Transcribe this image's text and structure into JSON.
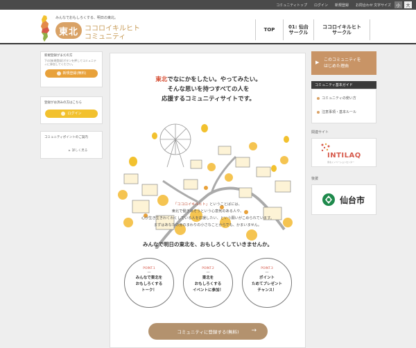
{
  "topbar": {
    "links": [
      "コミュニティトップ",
      "ログイン",
      "新規登録",
      "お問合わせ"
    ],
    "font_size_label": "文字サイズ",
    "font_small": "小",
    "font_large": "大"
  },
  "header": {
    "tagline": "みんなでおもしろくする、明日の東北。",
    "logo_mark": "東北",
    "logo_line1": "ココロイキルヒト",
    "logo_line2": "コミュニティ",
    "nav": [
      {
        "label": "TOP"
      },
      {
        "label": "01: 仙台\nサークル"
      },
      {
        "label": "ココロイキルヒト\nサークル"
      }
    ]
  },
  "left": {
    "register_title": "新規登録がまだの方",
    "register_desc": "下の[新規登録]ボタンを押してコミュニティに参加してください。",
    "register_button": "新規登録(無料)",
    "login_title": "登録がお済みの方はこちら",
    "login_button": "ログイン",
    "points_title": "コミュニティポイントのご案内",
    "points_link": "詳しく見る"
  },
  "main": {
    "headline_red": "東北",
    "headline_1": "でなにかをしたい。やってみたい。",
    "headline_2": "そんな思いを持つすべての人を",
    "headline_3": "応援するコミュニティサイトです。",
    "intro_quote": "「ココロイキルヒト」",
    "intro_1": "ということばには、",
    "intro_2": "東北で働き出そうという心意気のある人や、",
    "intro_3": "心が生き生きわくわくしている人を応援したい、という願いがこめられています。",
    "intro_4": "まずはあなたの身のまわりの小さなことからでも、かまいません。",
    "catch": "みんなで明日の東北を、おもしろくしていきませんか。",
    "points": [
      {
        "num": "POINT.1",
        "dash": "—",
        "text": [
          "みんなで東北を",
          "おもしろくする",
          "トーク！"
        ]
      },
      {
        "num": "POINT.2",
        "dash": "—",
        "text": [
          "東北を",
          "おもしろくする",
          "イベントに参加！"
        ]
      },
      {
        "num": "POINT.3",
        "dash": "—",
        "text": [
          "ポイント",
          "ためてプレゼント",
          "チャンス！"
        ]
      }
    ],
    "register_cta": "コミュニティに登録する(無料)",
    "arrow": "→"
  },
  "right": {
    "about_line1": "このコミュニティを",
    "about_line2": "はじめた理由",
    "about_arrow": "▶",
    "guide_title": "コミュニティ基本ガイド",
    "guide_items": [
      "コミュニティの使い方",
      "注意事項・基本ルール"
    ],
    "related_label": "関連サイト",
    "related_logo": "INTILAQ",
    "related_sub": "東北イノベーションセンター",
    "support_label": "後援",
    "support_logo": "仙台市"
  },
  "colors": {
    "accent_brown": "#c89466",
    "orange": "#e8a13a",
    "yellow": "#f2c12e",
    "red_text": "#d54a2f",
    "dark_bar": "#4a4a4a"
  }
}
